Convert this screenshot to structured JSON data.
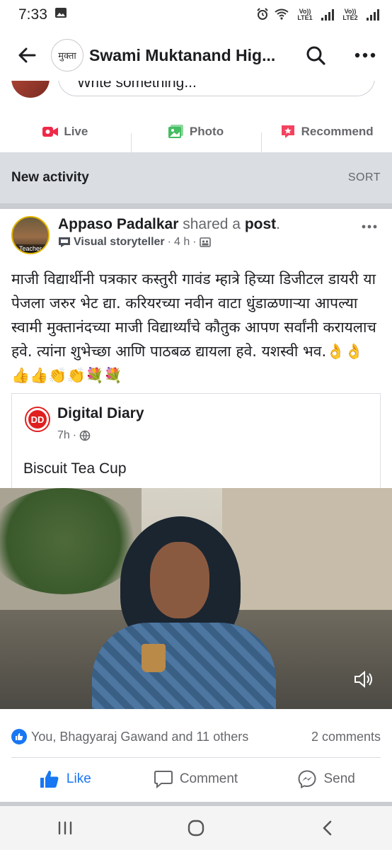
{
  "status_bar": {
    "time": "7:33",
    "lte1": "Vo)) LTE1",
    "lte2": "Vo)) LTE2"
  },
  "header": {
    "group_thumb_text": "मुक्ता",
    "title": "Swami Muktanand Hig..."
  },
  "composer": {
    "placeholder": "Write something..."
  },
  "actions": [
    {
      "label": "Live",
      "icon": "video-camera-icon",
      "color": "#f02849"
    },
    {
      "label": "Photo",
      "icon": "photo-icon",
      "color": "#45bd62"
    },
    {
      "label": "Recommend",
      "icon": "recommend-icon",
      "color": "#f3425f"
    }
  ],
  "section": {
    "title": "New activity",
    "sort": "SORT"
  },
  "post": {
    "avatar_tag": "Teacher",
    "author": "Appaso Padalkar",
    "verb": "shared a",
    "object": "post",
    "period": ".",
    "badge": "Visual storyteller",
    "time": "4 h",
    "text": "माजी विद्यार्थीनी पत्रकार कस्तुरी गावंड म्हात्रे हिच्या डिजीटल डायरी या पेजला जरुर भेट द्या. करियरच्या नवीन वाटा धुंडाळणाऱ्या आपल्या स्वामी मुक्तानंदच्या माजी विद्यार्थ्यांचे कौतुक आपण सर्वांनी करायलाच हवे. त्यांना शुभेच्छा आणि पाठबळ द्यायला हवे. यशस्वी भव.👌👌👍👍👏👏💐💐",
    "shared": {
      "logo_text": "DD",
      "name": "Digital Diary",
      "time": "7h",
      "caption": "Biscuit Tea Cup"
    },
    "reactions_text": "You, Bhagyaraj Gawand and 11 others",
    "comments_text": "2 comments",
    "buttons": {
      "like": "Like",
      "comment": "Comment",
      "send": "Send"
    }
  },
  "colors": {
    "facebook_blue": "#1877f2",
    "grey_text": "#65676b",
    "band": "#dadde1"
  }
}
